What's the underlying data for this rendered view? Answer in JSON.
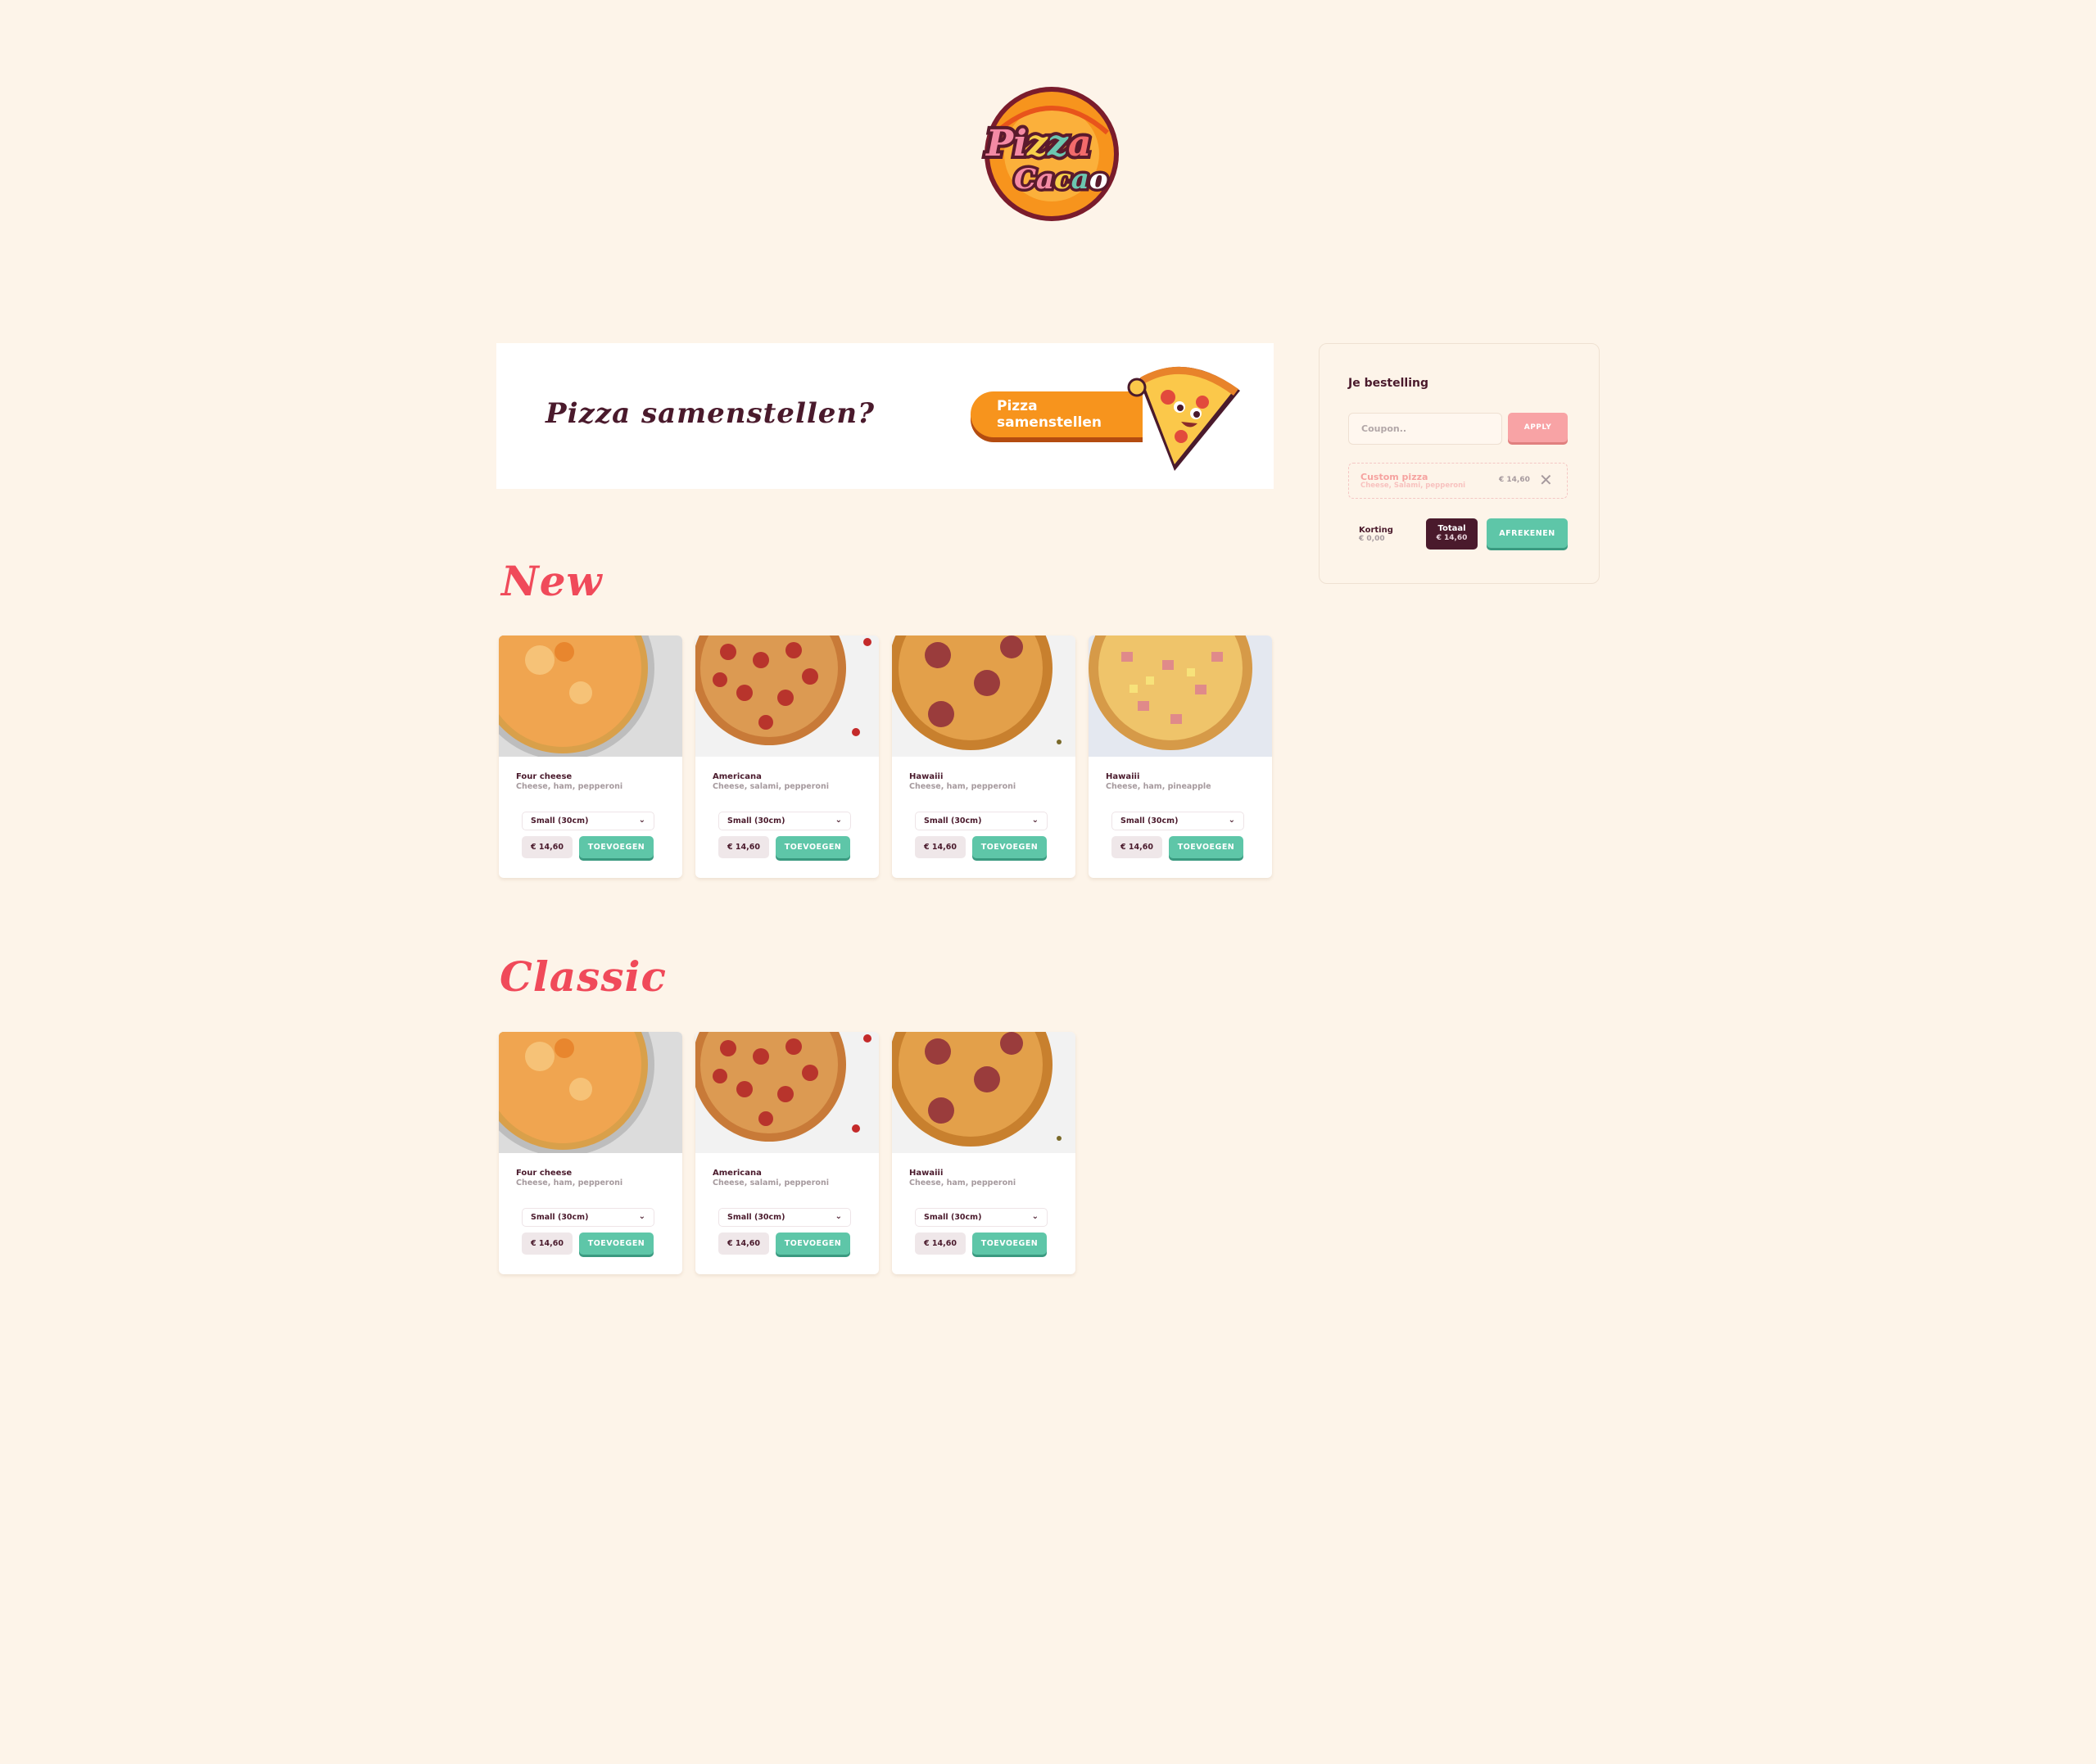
{
  "logo": {
    "line1": "Pizza",
    "line2": "Cacao"
  },
  "banner": {
    "title": "Pizza samenstellen?",
    "button_label": "Pizza samenstellen"
  },
  "sections": [
    {
      "title": "New",
      "items": [
        {
          "name": "Four cheese",
          "desc": "Cheese, ham, pepperoni",
          "size": "Small (30cm)",
          "price": "€ 14,60",
          "add_label": "TOEVOEGEN"
        },
        {
          "name": "Americana",
          "desc": "Cheese, salami, pepperoni",
          "size": "Small (30cm)",
          "price": "€ 14,60",
          "add_label": "TOEVOEGEN"
        },
        {
          "name": "Hawaiii",
          "desc": "Cheese, ham, pepperoni",
          "size": "Small (30cm)",
          "price": "€ 14,60",
          "add_label": "TOEVOEGEN"
        },
        {
          "name": "Hawaiii",
          "desc": "Cheese, ham, pineapple",
          "size": "Small (30cm)",
          "price": "€ 14,60",
          "add_label": "TOEVOEGEN"
        }
      ]
    },
    {
      "title": "Classic",
      "items": [
        {
          "name": "Four cheese",
          "desc": "Cheese, ham, pepperoni",
          "size": "Small (30cm)",
          "price": "€ 14,60",
          "add_label": "TOEVOEGEN"
        },
        {
          "name": "Americana",
          "desc": "Cheese, salami, pepperoni",
          "size": "Small (30cm)",
          "price": "€ 14,60",
          "add_label": "TOEVOEGEN"
        },
        {
          "name": "Hawaiii",
          "desc": "Cheese, ham, pepperoni",
          "size": "Small (30cm)",
          "price": "€ 14,60",
          "add_label": "TOEVOEGEN"
        }
      ]
    }
  ],
  "order": {
    "title": "Je bestelling",
    "coupon_placeholder": "Coupon..",
    "apply_label": "APPLY",
    "cart_item": {
      "name": "Custom pizza",
      "desc": "Cheese, Salami, pepperoni",
      "price": "€ 14,60"
    },
    "korting_label": "Korting",
    "korting_value": "€ 0,00",
    "totaal_label": "Totaal",
    "totaal_value": "€ 14,60",
    "checkout_label": "AFREKENEN"
  },
  "colors": {
    "background": "#fdf4e9",
    "brand_dark": "#4a1a2c",
    "accent_orange": "#f7941d",
    "accent_green": "#5ec6a8",
    "accent_red": "#f04a5a",
    "accent_pink": "#f8a3a5"
  }
}
